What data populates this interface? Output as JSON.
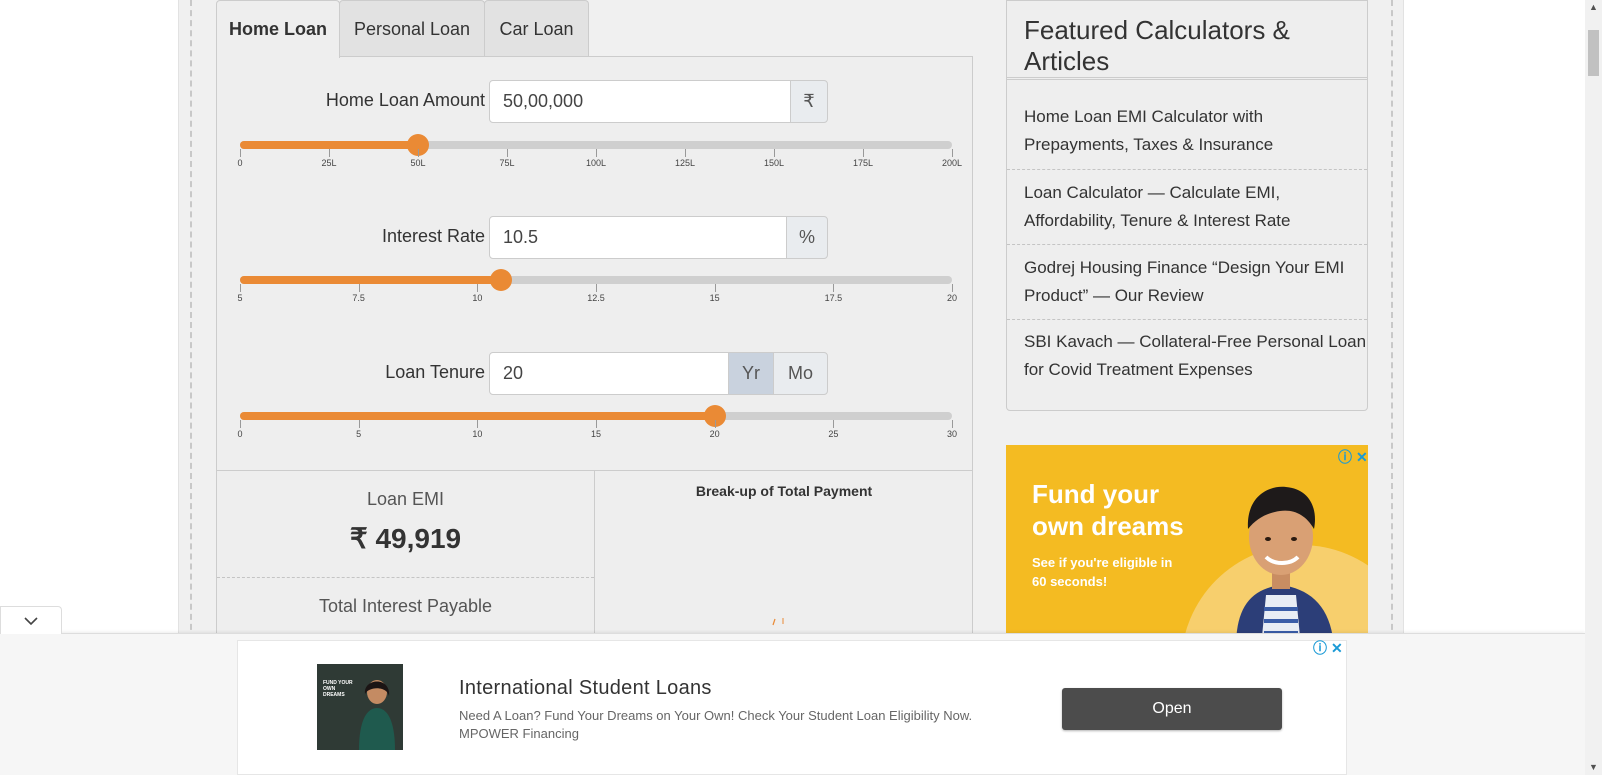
{
  "tabs": [
    "Home Loan",
    "Personal Loan",
    "Car Loan"
  ],
  "fields": {
    "amount": {
      "label": "Home Loan Amount",
      "value": "50,00,000",
      "unit": "₹",
      "slider_fraction": 0.25,
      "ticks": [
        "0",
        "25L",
        "50L",
        "75L",
        "100L",
        "125L",
        "150L",
        "175L",
        "200L"
      ]
    },
    "rate": {
      "label": "Interest Rate",
      "value": "10.5",
      "unit": "%",
      "slider_fraction": 0.3667,
      "ticks": [
        "5",
        "7.5",
        "10",
        "12.5",
        "15",
        "17.5",
        "20"
      ]
    },
    "tenure": {
      "label": "Loan Tenure",
      "value": "20",
      "unit_year": "Yr",
      "unit_month": "Mo",
      "selected_unit": "Yr",
      "slider_fraction": 0.6667,
      "ticks": [
        "0",
        "5",
        "10",
        "15",
        "20",
        "25",
        "30"
      ]
    }
  },
  "results": {
    "emi_label": "Loan EMI",
    "emi_value": "₹ 49,919",
    "interest_label": "Total Interest Payable",
    "breakup_title": "Break-up of Total Payment"
  },
  "sidebar": {
    "title": "Featured Calculators & Articles",
    "articles": [
      "Home Loan EMI Calculator with Prepayments, Taxes & Insurance",
      "Loan Calculator — Calculate EMI, Affordability, Tenure & Interest Rate",
      "Godrej Housing Finance “Design Your EMI Product” — Our Review",
      "SBI Kavach — Collateral-Free Personal Loan for Covid Treatment Expenses"
    ]
  },
  "side_ad": {
    "headline": "Fund your own dreams",
    "subtext": "See if you're eligible in 60 seconds!"
  },
  "anchor_ad": {
    "title": "International Student Loans",
    "description": "Need A Loan? Fund Your Dreams on Your Own! Check Your Student Loan Eligibility Now. MPOWER Financing",
    "button": "Open",
    "thumb_text": "FUND YOUR OWN DREAMS"
  },
  "colors": {
    "accent": "#ea8a35",
    "ad_yellow": "#f4bb22",
    "ad_blue": "#1a9ad6"
  }
}
